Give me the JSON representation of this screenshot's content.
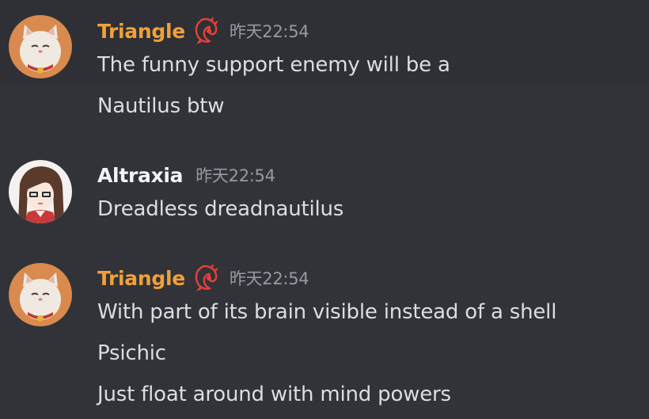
{
  "messages": [
    {
      "author": "Triangle",
      "author_color": "#f0a03a",
      "timestamp": "昨天22:54",
      "has_role_icon": true,
      "avatar": "cat-avatar",
      "lines": [
        "The funny support enemy will be a",
        "Nautilus btw"
      ]
    },
    {
      "author": "Altraxia",
      "author_color": "#f2f3f5",
      "timestamp": "昨天22:54",
      "has_role_icon": false,
      "avatar": "anime-girl-avatar",
      "lines": [
        "Dreadless dreadnautilus"
      ]
    },
    {
      "author": "Triangle",
      "author_color": "#f0a03a",
      "timestamp": "昨天22:54",
      "has_role_icon": true,
      "avatar": "cat-avatar",
      "lines": [
        "With part of its brain visible instead of a shell",
        "Psichic",
        "Just float around with mind powers"
      ]
    }
  ],
  "colors": {
    "background": "#313338",
    "hover_background": "#2e3035",
    "text": "#dbdee1",
    "timestamp": "#949ba4",
    "role_icon": "#e8403a"
  }
}
